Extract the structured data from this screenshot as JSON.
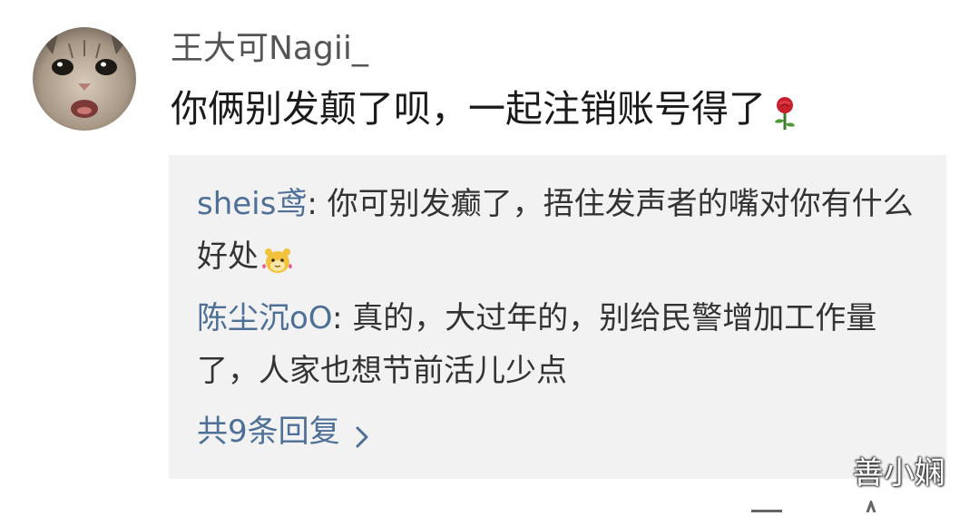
{
  "comment": {
    "author": "王大可Nagii_",
    "text": "你俩别发颠了呗，一起注销账号得了",
    "emoji": "rose-emoji"
  },
  "replies": [
    {
      "name": "sheis鸢",
      "separator": ": ",
      "text": "你可别发癫了，捂住发声者的嘴对你有什么好处",
      "emoji": "hamster-emoji"
    },
    {
      "name": "陈尘沉oO",
      "separator": ": ",
      "text": "真的，大过年的，别给民警增加工作量了，人家也想节前活儿少点"
    }
  ],
  "more_replies_label": "共9条回复",
  "watermark": "善小娴",
  "colors": {
    "link": "#4e6f96",
    "reply_bg": "#f2f2f2",
    "text": "#1a1a1a",
    "author": "#555555"
  }
}
